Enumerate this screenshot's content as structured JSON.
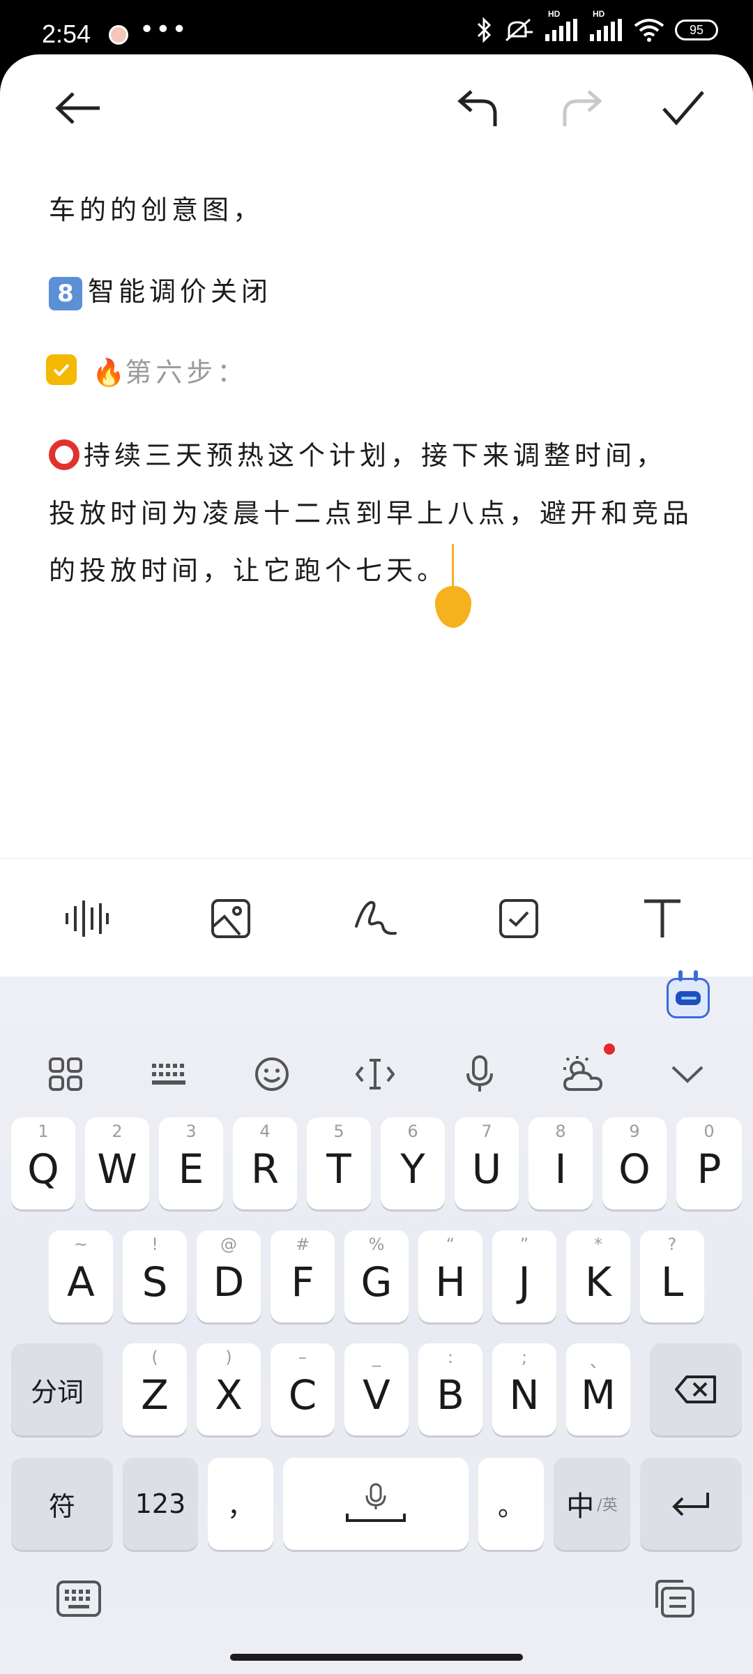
{
  "status_bar": {
    "time": "2:54",
    "dots": "•••",
    "battery": "95",
    "hd1": "HD",
    "hd2": "HD"
  },
  "note": {
    "line1": "车的的创意图，",
    "line2_emoji": "8",
    "line2": "智能调价关闭",
    "line3_emoji": "🔥",
    "line3": "第六步：",
    "para_lines": [
      "持续三天预热这个计划，接下来调整时间，",
      "投放时间为凌晨十二点到早上八点，避开和竞品",
      "的投放时间，让它跑个七天。"
    ]
  },
  "icons": {
    "back": "back-arrow-icon",
    "undo": "undo-icon",
    "redo": "redo-icon",
    "done": "checkmark-icon"
  },
  "colors": {
    "accent": "#f5b800",
    "cursor": "#f5b21e",
    "redo_disabled": "#c9c9c9"
  },
  "keyboard": {
    "row1": [
      {
        "sub": "1",
        "key": "Q"
      },
      {
        "sub": "2",
        "key": "W"
      },
      {
        "sub": "3",
        "key": "E"
      },
      {
        "sub": "4",
        "key": "R"
      },
      {
        "sub": "5",
        "key": "T"
      },
      {
        "sub": "6",
        "key": "Y"
      },
      {
        "sub": "7",
        "key": "U"
      },
      {
        "sub": "8",
        "key": "I"
      },
      {
        "sub": "9",
        "key": "O"
      },
      {
        "sub": "0",
        "key": "P"
      }
    ],
    "row2": [
      {
        "sub": "~",
        "key": "A"
      },
      {
        "sub": "!",
        "key": "S"
      },
      {
        "sub": "@",
        "key": "D"
      },
      {
        "sub": "#",
        "key": "F"
      },
      {
        "sub": "%",
        "key": "G"
      },
      {
        "sub": "“",
        "key": "H"
      },
      {
        "sub": "”",
        "key": "J"
      },
      {
        "sub": "*",
        "key": "K"
      },
      {
        "sub": "?",
        "key": "L"
      }
    ],
    "row3": [
      {
        "sub": "(",
        "key": "Z"
      },
      {
        "sub": ")",
        "key": "X"
      },
      {
        "sub": "–",
        "key": "C"
      },
      {
        "sub": "_",
        "key": "V"
      },
      {
        "sub": ":",
        "key": "B"
      },
      {
        "sub": ";",
        "key": "N"
      },
      {
        "sub": "、",
        "key": "M"
      }
    ],
    "segment_label": "分词",
    "symbol_label": "符",
    "numbers_label": "123",
    "comma_label": "，",
    "period_label": "。",
    "lang_main": "中",
    "lang_sub": "/英"
  }
}
